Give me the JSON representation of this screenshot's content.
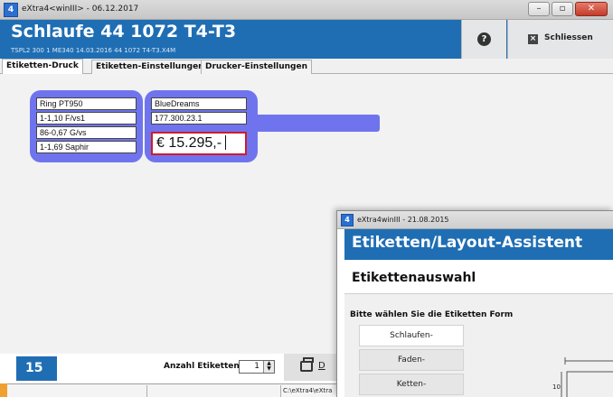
{
  "main_window": {
    "title": "eXtra4<winIII> - 06.12.2017",
    "header": {
      "title": "Schlaufe 44 1072 T4-T3",
      "subtitle": "TSPL2    300 1    ME340  14.03.2016  44 1072 T4-T3.X4M",
      "help_symbol": "?",
      "close_label": "Schliessen"
    },
    "tabs": [
      "Etiketten-Druck",
      "Etiketten-Einstellungen",
      "Drucker-Einstellungen"
    ],
    "label_left": [
      "Ring PT950",
      "1-1,10 F/vs1",
      "86-0,67 G/vs",
      "1-1,69 Saphir"
    ],
    "label_right": [
      "BlueDreams",
      "177.300.23.1"
    ],
    "price": "€  15.295,-",
    "count_badge": "15",
    "anzahl_label": "Anzahl Etiketten",
    "anzahl_value": "1",
    "print_label": "D",
    "status_path": "C:\\eXtra4\\eXtra"
  },
  "assistant_window": {
    "title": "eXtra4winIII  - 21.08.2015",
    "header": "Etiketten/Layout-Assistent",
    "subheader": "Etikettenauswahl",
    "prompt": "Bitte wählen Sie die Etiketten Form",
    "options": [
      "Schlaufen-",
      "Faden-",
      "Ketten-"
    ],
    "selected_option": "Schlaufen-",
    "diagram_label": "10"
  },
  "colors": {
    "header_blue": "#1f6eb4",
    "label_box_purple": "#6f74ee",
    "price_border_red": "#d11a2a"
  }
}
